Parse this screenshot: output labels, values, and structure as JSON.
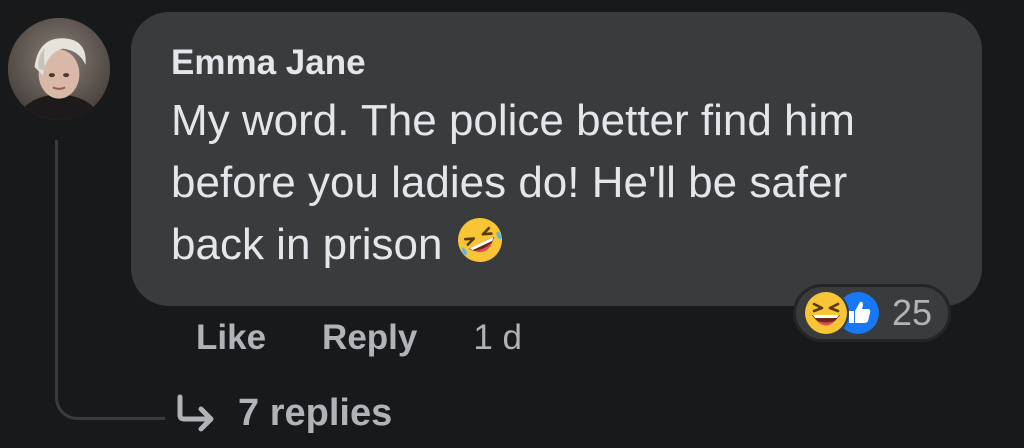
{
  "comment": {
    "author": "Emma Jane",
    "text": "My word. The police better find him before you ladies do! He'll be safer back in prison",
    "trailing_emoji": "rolling-on-floor-laughing",
    "avatar": "profile-photo"
  },
  "reactions": {
    "icons": [
      "haha-reaction",
      "like-reaction"
    ],
    "count": "25"
  },
  "actions": {
    "like_label": "Like",
    "reply_label": "Reply",
    "timestamp": "1 d"
  },
  "replies": {
    "label": "7 replies"
  },
  "colors": {
    "background": "#18191a",
    "bubble": "#3a3b3c",
    "primary_text": "#e4e6eb",
    "secondary_text": "#b0b3b8",
    "like_blue": "#1877f2",
    "haha_yellow": "#f7c535"
  }
}
